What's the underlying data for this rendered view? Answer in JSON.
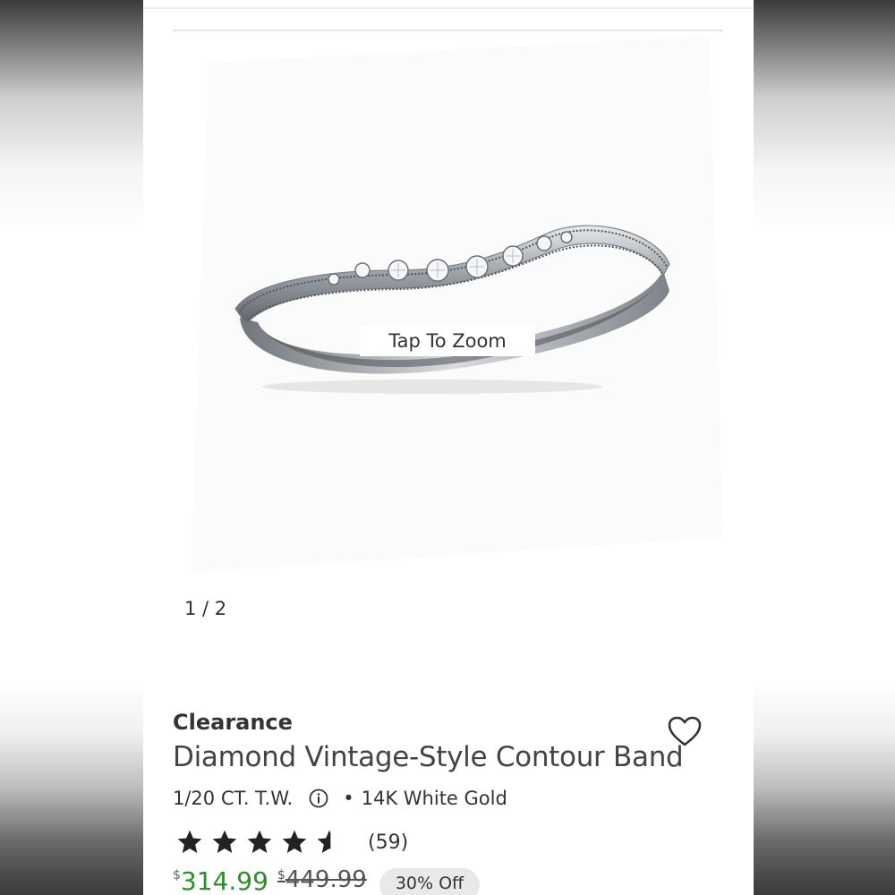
{
  "gallery": {
    "zoom_hint": "Tap To Zoom",
    "counter": "1 / 2"
  },
  "product": {
    "badge": "Clearance",
    "title": "Diamond Vintage-Style Contour Band",
    "carat": "1/20 CT. T.W.",
    "separator": "•",
    "metal": "14K White Gold",
    "rating_value": 4.5,
    "rating_max": 5,
    "review_count": "(59)",
    "price": {
      "currency_symbol": "$",
      "sale_amount": "314.99",
      "original_amount": "449.99",
      "discount": "30% Off"
    }
  },
  "icons": {
    "wishlist": "heart-outline-icon",
    "info": "info-circle-icon",
    "star": "star-icon"
  },
  "colors": {
    "sale_price": "#2e8b2e",
    "text": "#333333",
    "badge_bg": "#e9e9e9"
  }
}
